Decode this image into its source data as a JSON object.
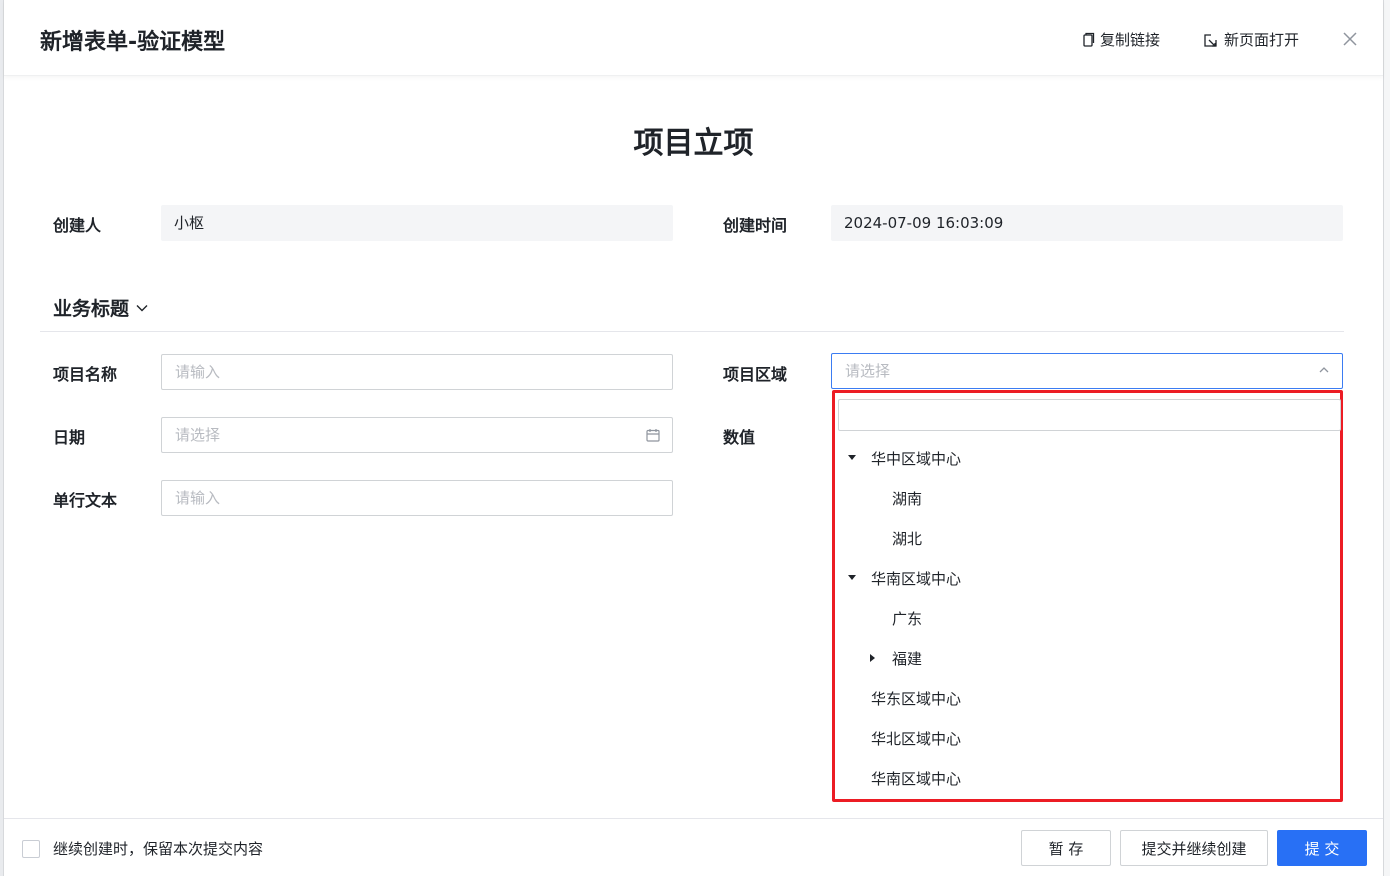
{
  "header": {
    "title": "新增表单-验证模型",
    "copy_link": "复制链接",
    "open_new_page": "新页面打开",
    "close_icon": "close-icon"
  },
  "form": {
    "title": "项目立项",
    "creator_label": "创建人",
    "creator_value": "小枢",
    "created_time_label": "创建时间",
    "created_time_value": "2024-07-09 16:03:09",
    "section_title": "业务标题",
    "project_name_label": "项目名称",
    "project_name_placeholder": "请输入",
    "project_region_label": "项目区域",
    "project_region_placeholder": "请选择",
    "date_label": "日期",
    "date_placeholder": "请选择",
    "number_label": "数值",
    "single_text_label": "单行文本",
    "single_text_placeholder": "请输入"
  },
  "region_tree": [
    {
      "label": "华中区域中心",
      "level": 0,
      "expander": "expanded"
    },
    {
      "label": "湖南",
      "level": 1,
      "expander": "none"
    },
    {
      "label": "湖北",
      "level": 1,
      "expander": "none"
    },
    {
      "label": "华南区域中心",
      "level": 0,
      "expander": "expanded"
    },
    {
      "label": "广东",
      "level": 1,
      "expander": "none"
    },
    {
      "label": "福建",
      "level": 1,
      "expander": "collapsed"
    },
    {
      "label": "华东区域中心",
      "level": 0,
      "expander": "none"
    },
    {
      "label": "华北区域中心",
      "level": 0,
      "expander": "none"
    },
    {
      "label": "华南区域中心",
      "level": 0,
      "expander": "none"
    }
  ],
  "footer": {
    "keep_content_label": "继续创建时，保留本次提交内容",
    "save_draft": "暂 存",
    "submit_continue": "提交并继续创建",
    "submit": "提 交"
  },
  "colors": {
    "primary": "#2870f5",
    "focus_border": "#3b7cf2",
    "highlight_box": "#ec1c24",
    "readonly_bg": "#f4f5f7"
  }
}
